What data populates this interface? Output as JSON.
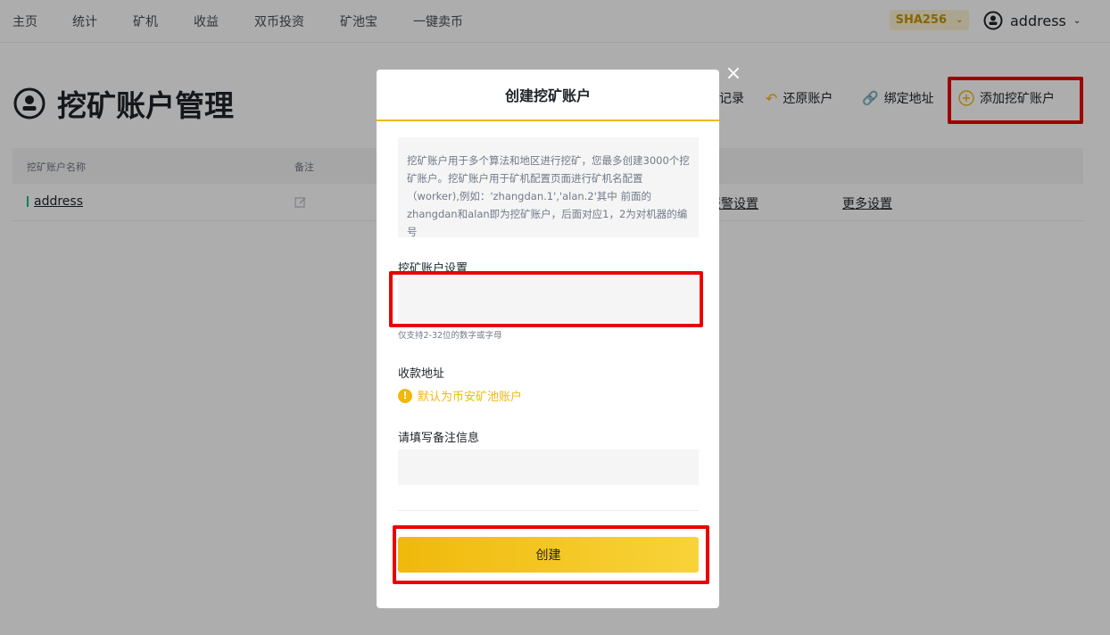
{
  "nav": {
    "items": [
      "主页",
      "统计",
      "矿机",
      "收益",
      "双币投资",
      "矿池宝",
      "一键卖币"
    ],
    "algorithm": "SHA256",
    "user": "address"
  },
  "page": {
    "title": "挖矿账户管理",
    "actions": {
      "records": "记录",
      "restore": "还原账户",
      "bind": "绑定地址",
      "add": "添加挖矿账户"
    }
  },
  "table": {
    "headers": [
      "挖矿账户名称",
      "备注"
    ],
    "rows": [
      {
        "name": "address",
        "alert": "报警设置",
        "more": "更多设置"
      }
    ]
  },
  "modal": {
    "title": "创建挖矿账户",
    "info": "挖矿账户用于多个算法和地区进行挖矿，您最多创建3000个挖矿账户。挖矿账户用于矿机配置页面进行矿机名配置（worker),例如：'zhangdan.1','alan.2'其中 前面的zhangdan和alan即为挖矿账户，后面对应1，2为对机器的编号",
    "account_label": "挖矿账户设置",
    "account_value": "",
    "account_hint": "仅支持2-32位的数字或字母",
    "address_label": "收款地址",
    "address_default": "默认为币安矿池账户",
    "remark_label": "请填写备注信息",
    "remark_value": "",
    "create_button": "创建"
  },
  "colors": {
    "accent": "#f0b90b",
    "highlight": "#ea0000"
  }
}
